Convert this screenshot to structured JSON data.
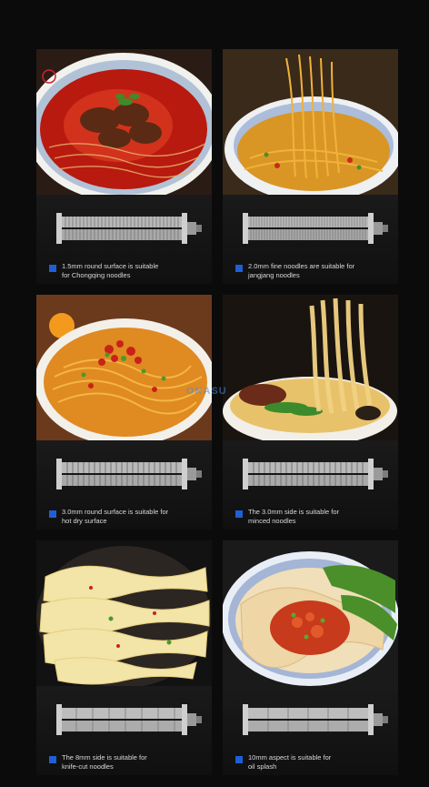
{
  "watermark": "OKASU",
  "colors": {
    "background": "#0b0b0b",
    "bullet": "#1e5fd6",
    "card": "#141414"
  },
  "cards": [
    {
      "caption_line1": "1.5mm round surface is suitable",
      "caption_line2": "for Chongqing noodles",
      "dish": "spicy beef noodle soup"
    },
    {
      "caption_line1": "2.0mm fine noodles are suitable for",
      "caption_line2": "jangjang noodles",
      "dish": "noodles lifted with chopsticks"
    },
    {
      "caption_line1": "3.0mm round surface is suitable for",
      "caption_line2": "hot dry surface",
      "dish": "hot dry noodles with chili"
    },
    {
      "caption_line1": "The 3.0mm side is suitable for",
      "caption_line2": "minced noodles",
      "dish": "flat noodles with minced meat"
    },
    {
      "caption_line1": "The 8mm side is suitable for",
      "caption_line2": "knife-cut noodles",
      "dish": "knife-cut noodles"
    },
    {
      "caption_line1": "10mm aspect is suitable for",
      "caption_line2": "oil splash",
      "dish": "oil-splashed wide noodles"
    }
  ]
}
